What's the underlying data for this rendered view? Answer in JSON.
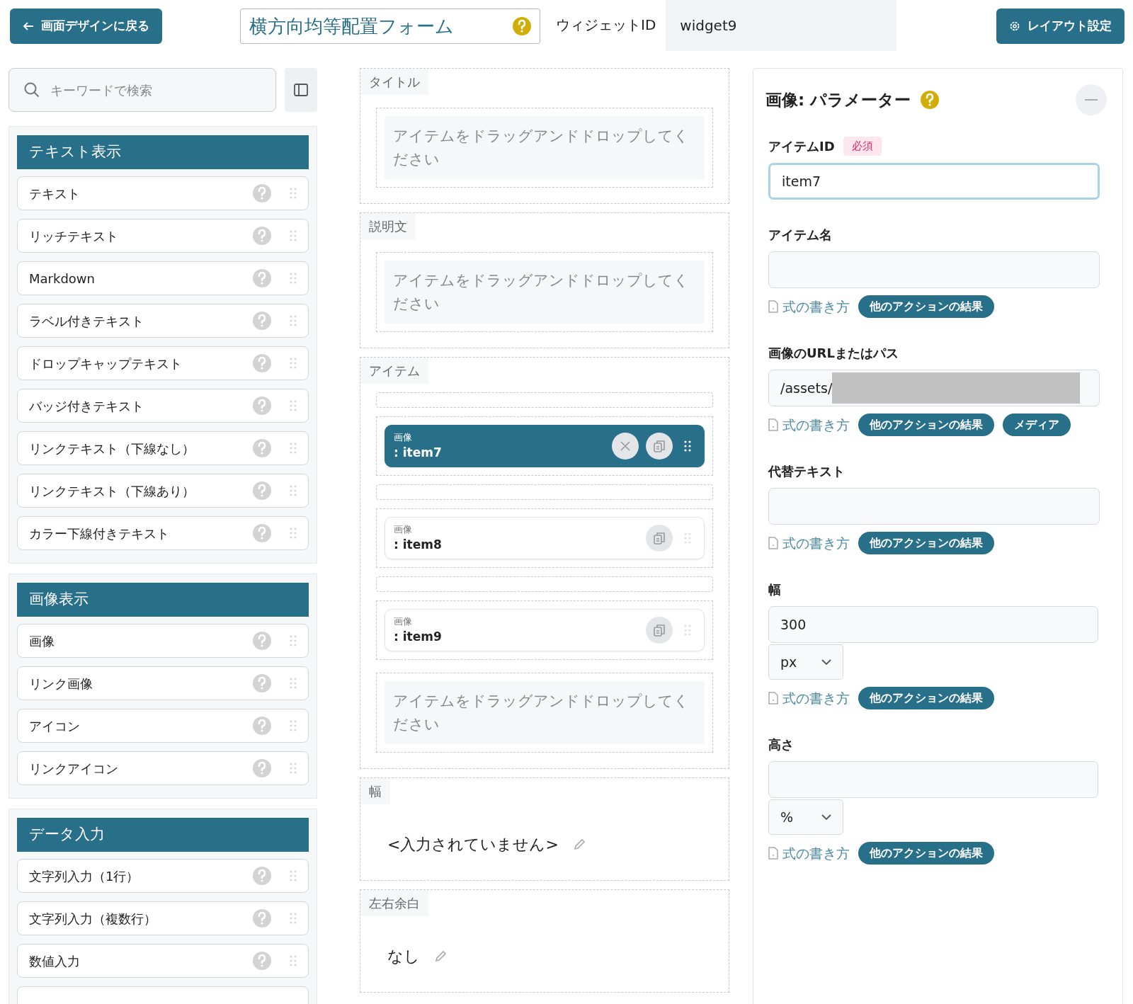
{
  "header": {
    "back_button": "画面デザインに戻る",
    "form_title": "横方向均等配置フォーム",
    "widget_id_label": "ウィジェットID",
    "widget_id": "widget9",
    "layout_button": "レイアウト設定"
  },
  "palette": {
    "search_placeholder": "キーワードで検索",
    "sections": [
      {
        "title": "テキスト表示",
        "items": [
          {
            "kind": "item",
            "label": "テキスト"
          },
          {
            "kind": "item",
            "label": "リッチテキスト"
          },
          {
            "kind": "item",
            "label": "Markdown"
          },
          {
            "kind": "item",
            "label": "ラベル付きテキスト"
          },
          {
            "kind": "item",
            "label": "ドロップキャップテキスト"
          },
          {
            "kind": "item",
            "label": "バッジ付きテキスト"
          },
          {
            "kind": "item",
            "label": "リンクテキスト（下線なし）"
          },
          {
            "kind": "item",
            "label": "リンクテキスト（下線あり）"
          },
          {
            "kind": "item",
            "label": "カラー下線付きテキスト"
          }
        ]
      },
      {
        "title": "画像表示",
        "items": [
          {
            "kind": "item",
            "label": "画像"
          },
          {
            "kind": "item",
            "label": "リンク画像"
          },
          {
            "kind": "item",
            "label": "アイコン"
          },
          {
            "kind": "item",
            "label": "リンクアイコン"
          }
        ]
      },
      {
        "title": "データ入力",
        "items": [
          {
            "kind": "item",
            "label": "文字列入力（1行）"
          },
          {
            "kind": "item",
            "label": "文字列入力（複数行）"
          },
          {
            "kind": "item",
            "label": "数値入力"
          },
          {
            "kind": "cut"
          }
        ]
      }
    ]
  },
  "canvas": {
    "sections": [
      {
        "kind": "drop",
        "label": "タイトル",
        "placeholder": "アイテムをドラッグアンドドロップしてください"
      },
      {
        "kind": "drop",
        "label": "説明文",
        "placeholder": "アイテムをドラッグアンドドロップしてください"
      },
      {
        "kind": "items",
        "label": "アイテム",
        "slots": [
          {
            "kind": "gap"
          },
          {
            "kind": "widget",
            "type": "画像",
            "id": ": item7",
            "selected": true
          },
          {
            "kind": "gap"
          },
          {
            "kind": "widget",
            "type": "画像",
            "id": ": item8",
            "selected": false
          },
          {
            "kind": "gap"
          },
          {
            "kind": "widget",
            "type": "画像",
            "id": ": item9",
            "selected": false
          },
          {
            "kind": "drop",
            "placeholder": "アイテムをドラッグアンドドロップしてください"
          }
        ]
      },
      {
        "kind": "value",
        "label": "幅",
        "value": "<入力されていません>"
      },
      {
        "kind": "value",
        "label": "左右余白",
        "value": "なし"
      }
    ]
  },
  "parameters": {
    "title": "画像: パラメーター",
    "fields": [
      {
        "label": "アイテムID",
        "required_badge": "必須",
        "value": "item7",
        "focused": true
      },
      {
        "label": "アイテム名",
        "help_link": "式の書き方",
        "chips": [
          "他のアクションの結果"
        ]
      },
      {
        "label": "画像のURLまたはパス",
        "value": "/assets/",
        "redacted": true,
        "help_link": "式の書き方",
        "chips": [
          "他のアクションの結果",
          "メディア"
        ]
      },
      {
        "label": "代替テキスト",
        "help_link": "式の書き方",
        "chips": [
          "他のアクションの結果"
        ]
      },
      {
        "label": "幅",
        "value": "300",
        "unit": "px",
        "help_link": "式の書き方",
        "chips": [
          "他のアクションの結果"
        ]
      },
      {
        "label": "高さ",
        "unit": "%",
        "help_link": "式の書き方",
        "chips": [
          "他のアクションの結果"
        ]
      }
    ]
  }
}
